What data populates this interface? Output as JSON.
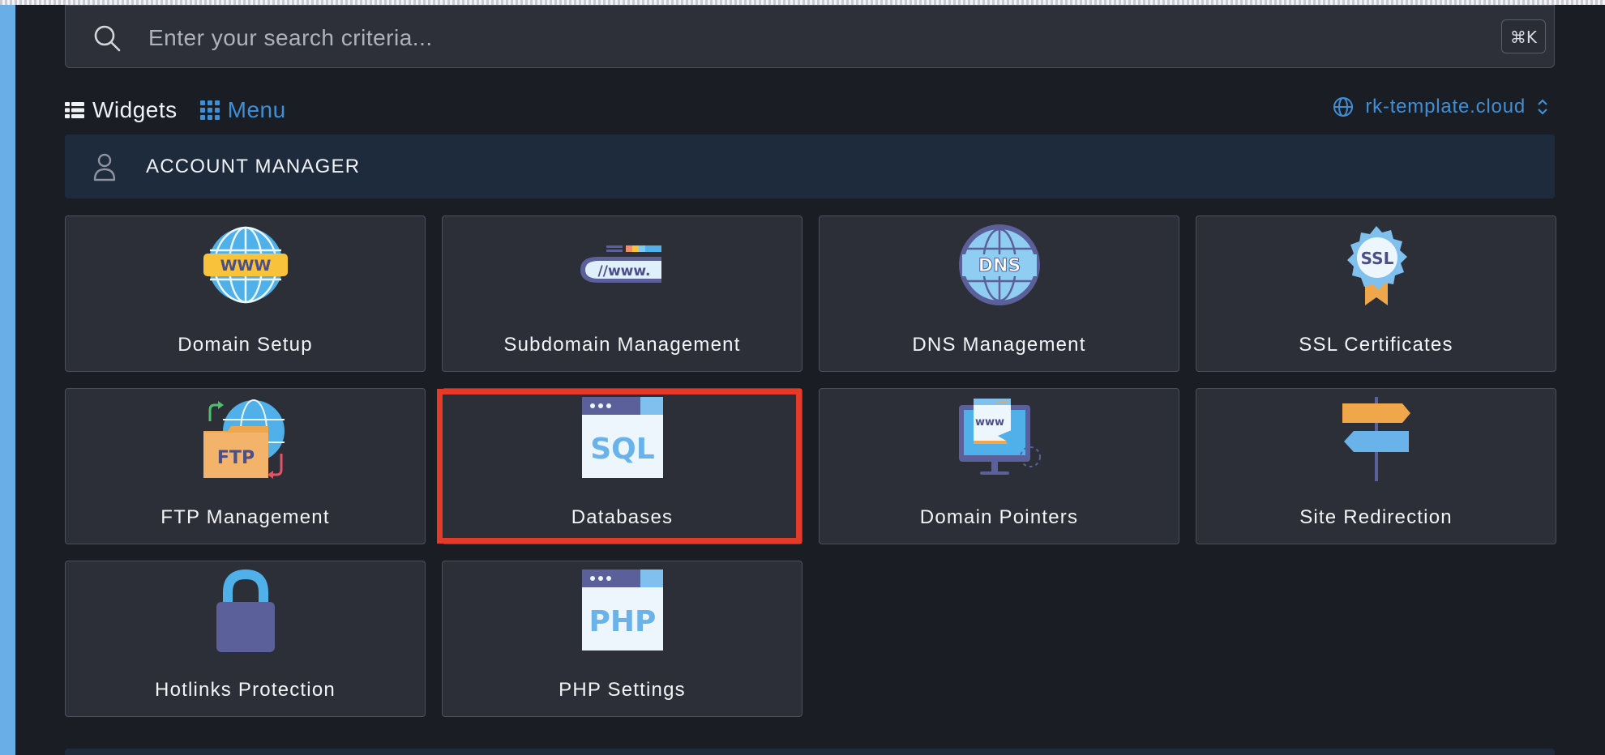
{
  "search": {
    "placeholder": "Enter your search criteria...",
    "shortcut": "⌘K"
  },
  "view_tabs": {
    "widgets": "Widgets",
    "menu": "Menu"
  },
  "domain_selector": {
    "value": "rk-template.cloud"
  },
  "section": {
    "title": "ACCOUNT MANAGER"
  },
  "cards": [
    {
      "label": "Domain Setup",
      "icon": "www-globe-icon"
    },
    {
      "label": "Subdomain Management",
      "icon": "url-bar-icon"
    },
    {
      "label": "DNS Management",
      "icon": "dns-globe-icon"
    },
    {
      "label": "SSL Certificates",
      "icon": "ssl-badge-icon"
    },
    {
      "label": "FTP Management",
      "icon": "ftp-folder-icon"
    },
    {
      "label": "Databases",
      "icon": "sql-window-icon"
    },
    {
      "label": "Domain Pointers",
      "icon": "domain-pointer-monitor-icon"
    },
    {
      "label": "Site Redirection",
      "icon": "signpost-icon"
    },
    {
      "label": "Hotlinks Protection",
      "icon": "padlock-icon"
    },
    {
      "label": "PHP Settings",
      "icon": "php-window-icon"
    }
  ],
  "highlighted_card": "Databases",
  "colors": {
    "accent": "#3e8fd6",
    "highlight": "#e5392a",
    "section_bg": "#1d2b3d",
    "card_bg": "#2c2f37",
    "page_bg": "#1b1d24"
  }
}
